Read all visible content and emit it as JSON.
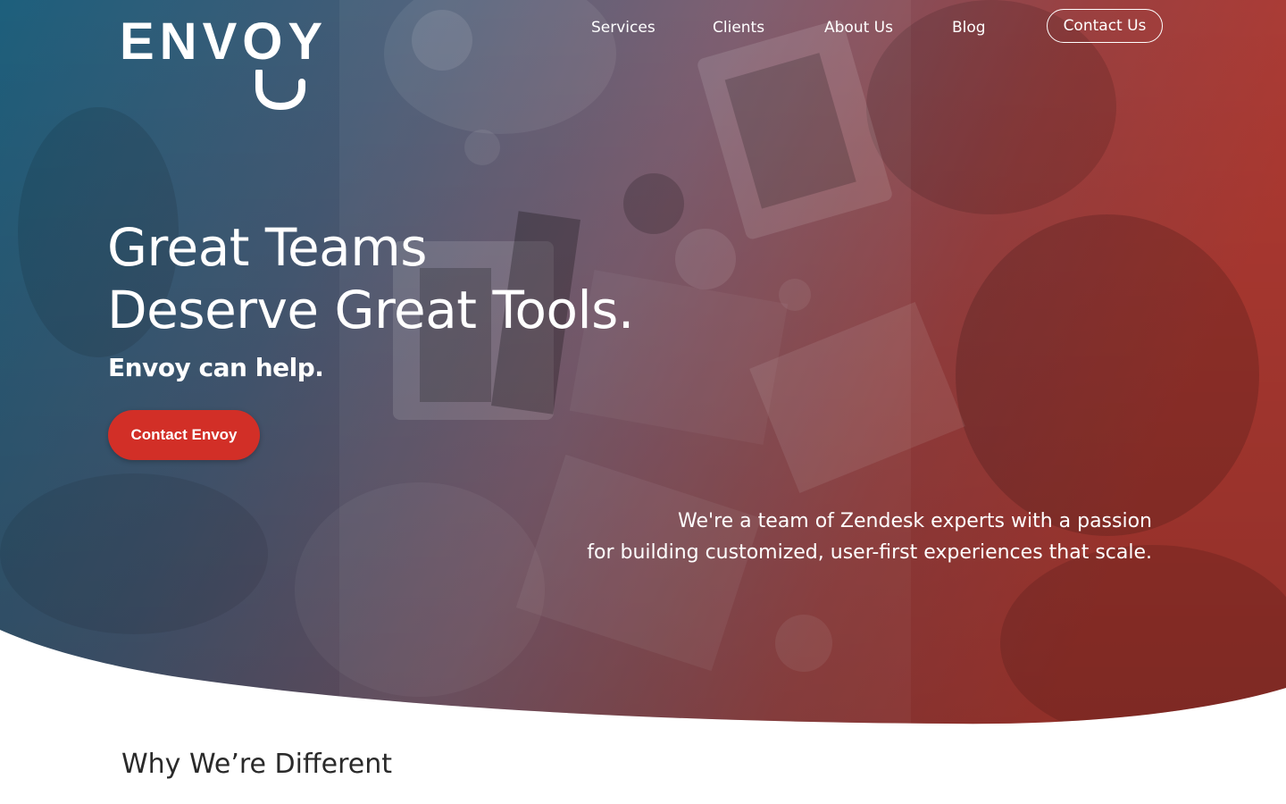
{
  "brand": {
    "logo_text": "ENVOY",
    "colors": {
      "teal": "#1e5f7a",
      "red": "#b8322c",
      "cta": "#d22f27"
    }
  },
  "nav": {
    "items": [
      {
        "label": "Services"
      },
      {
        "label": "Clients"
      },
      {
        "label": "About Us"
      },
      {
        "label": "Blog"
      }
    ],
    "contact_button": "Contact Us"
  },
  "hero": {
    "headline_line1": "Great Teams",
    "headline_line2": "Deserve Great Tools.",
    "subheadline": "Envoy can help.",
    "cta_label": "Contact Envoy",
    "tagline_line1": "We're a team of Zendesk experts with a passion",
    "tagline_line2": "for building customized, user-first experiences that scale.",
    "background_image": "overhead-office-meeting-photo"
  },
  "section": {
    "title": "Why We’re Different"
  }
}
